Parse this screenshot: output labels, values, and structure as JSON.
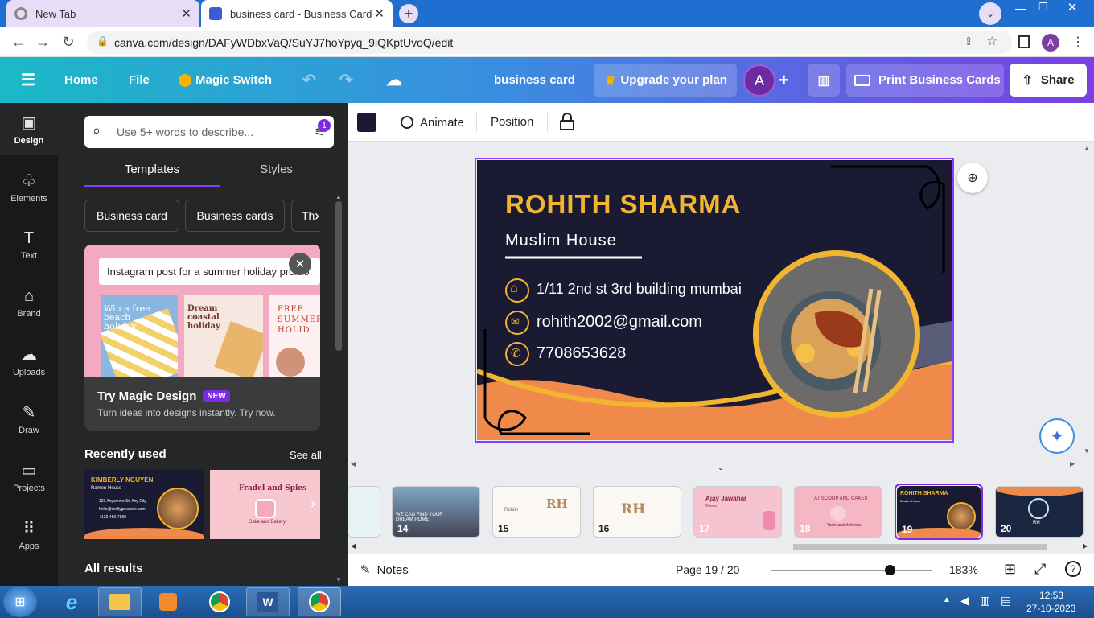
{
  "browser": {
    "tabs": [
      {
        "title": "New Tab",
        "active": false
      },
      {
        "title": "business card - Business Card",
        "active": true
      }
    ],
    "url": "canva.com/design/DAFyWDbxVaQ/SuYJ7hoYpyq_9iQKptUvoQ/edit",
    "profile_initial": "A"
  },
  "topbar": {
    "home": "Home",
    "file": "File",
    "magic_switch": "Magic Switch",
    "doc_title": "business card",
    "upgrade": "Upgrade your plan",
    "avatar": "A",
    "print": "Print Business Cards",
    "share": "Share"
  },
  "rail": [
    {
      "label": "Design",
      "icon": "design-icon"
    },
    {
      "label": "Elements",
      "icon": "elements-icon"
    },
    {
      "label": "Text",
      "icon": "text-icon"
    },
    {
      "label": "Brand",
      "icon": "brand-icon"
    },
    {
      "label": "Uploads",
      "icon": "uploads-icon"
    },
    {
      "label": "Draw",
      "icon": "draw-icon"
    },
    {
      "label": "Projects",
      "icon": "projects-icon"
    },
    {
      "label": "Apps",
      "icon": "apps-icon"
    }
  ],
  "panel": {
    "search_placeholder": "Use 5+ words to describe...",
    "filter_badge": "1",
    "tabs": [
      "Templates",
      "Styles"
    ],
    "chips": [
      "Business card",
      "Business cards",
      "Th"
    ],
    "promo": {
      "prompt": "Instagram post for a summer holiday promo",
      "img_texts": [
        "Win a free beach holiday",
        "Dream coastal holiday",
        "FREE SUMMER HOLID"
      ],
      "title": "Try Magic Design",
      "badge": "NEW",
      "subtitle": "Turn ideas into designs instantly. Try now."
    },
    "recent_heading": "Recently used",
    "see_all": "See all",
    "recent": [
      {
        "name": "KIMBERLY NGUYEN",
        "sub": "Ramen House",
        "lines": [
          "123 Anywhere St. Any City",
          "hello@reallygreatsite.com",
          "+123-456-7890"
        ]
      },
      {
        "name": "Fradel and Spies",
        "sub": "Cake and Bakery"
      }
    ],
    "all_results": "All results"
  },
  "ctxbar": {
    "color": "#1a1a33",
    "animate": "Animate",
    "position": "Position"
  },
  "card": {
    "name": "ROHITH SHARMA",
    "company": "Muslim House",
    "address": "1/11 2nd st 3rd building mumbai",
    "email": "rohith2002@gmail.com",
    "phone": "7708653628"
  },
  "thumbs": [
    {
      "n": "14",
      "text": "WE CAN FIND YOUR DREAM HOME"
    },
    {
      "n": "15",
      "text": "RH",
      "sub": "Rohith"
    },
    {
      "n": "16",
      "text": "RH"
    },
    {
      "n": "17",
      "text": "Ajay Jawahar",
      "sub": "Owner"
    },
    {
      "n": "18",
      "text": "AT SCOOP AND CAKES",
      "sub": "Taste and delicious"
    },
    {
      "n": "19",
      "text": "ROHITH SHARMA",
      "sub": "Muslim House"
    },
    {
      "n": "20",
      "text": "RH"
    }
  ],
  "footer": {
    "notes": "Notes",
    "page": "Page 19 / 20",
    "zoom": "183%",
    "zoom_level": 0.74
  },
  "taskbar": {
    "time": "12:53",
    "date": "27-10-2023"
  },
  "colors": {
    "accent": "#7d2ae8",
    "card_bg": "#1a1a33",
    "gold": "#f2b531",
    "orange": "#f08a4b"
  }
}
